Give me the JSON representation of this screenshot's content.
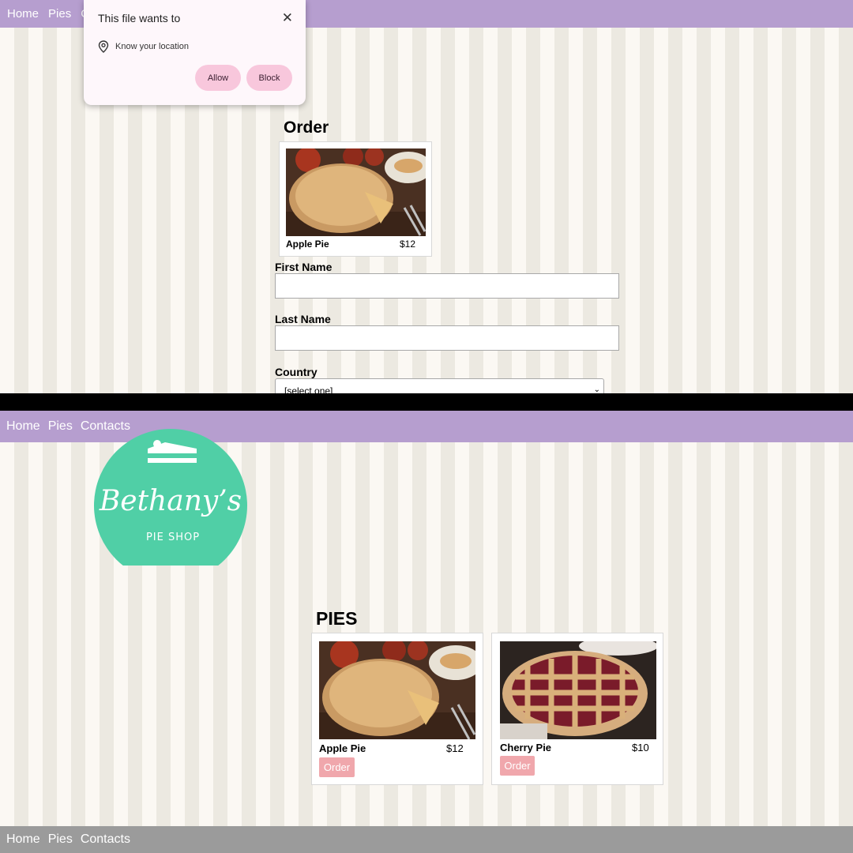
{
  "top": {
    "nav": [
      "Home",
      "Pies",
      "C"
    ],
    "popup": {
      "title": "This file wants to",
      "close": "✕",
      "permission": "Know your location",
      "allow": "Allow",
      "block": "Block"
    },
    "order_title": "Order",
    "card": {
      "name": "Apple Pie",
      "price": "$12"
    },
    "first_name_label": "First Name",
    "last_name_label": "Last Name",
    "country_label": "Country",
    "country_value": "[select one]"
  },
  "bottom": {
    "nav": [
      "Home",
      "Pies",
      "Contacts"
    ],
    "logo": {
      "name": "Bethany's",
      "sub": "Pie Shop"
    },
    "pies_title": "PIES",
    "pies": [
      {
        "name": "Apple Pie",
        "price": "$12",
        "button": "Order"
      },
      {
        "name": "Cherry Pie",
        "price": "$10",
        "button": "Order"
      }
    ],
    "footer": [
      "Home",
      "Pies",
      "Contacts"
    ]
  },
  "colors": {
    "nav": "#b69ecf",
    "footer": "#9b9b9b",
    "logo": "#50cfa6",
    "order_button": "#f0a7ac",
    "popup_button": "#f8c7dc"
  }
}
